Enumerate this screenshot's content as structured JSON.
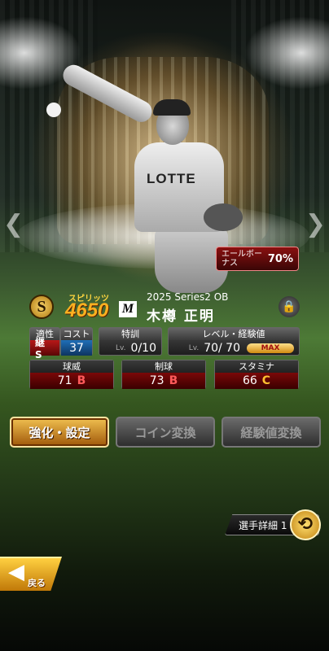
{
  "card": {
    "yell_bonus_label": "エールボーナス",
    "yell_bonus_value": "70%",
    "rank": "S",
    "spirits_label": "スピリッツ",
    "spirits_value": "4650",
    "team_logo": "M",
    "series": "2025 Series2 OB",
    "player_name": "木樽 正明",
    "jersey_text": "LOTTE",
    "icons": {
      "lock": "lock-icon",
      "prev": "chevron-left-icon",
      "next": "chevron-right-icon",
      "swap": "swap-icon",
      "back": "back-arrow-icon"
    }
  },
  "stats": {
    "aptitude": {
      "label": "適性",
      "value": "継 S"
    },
    "cost": {
      "label": "コスト",
      "value": "37"
    },
    "training": {
      "label": "特訓",
      "lv": "Lv.",
      "value": "0/10"
    },
    "level": {
      "label": "レベル・経験値",
      "lv": "Lv.",
      "value": "70/ 70",
      "max": "MAX"
    },
    "power": {
      "label": "球威",
      "value": "71",
      "grade": "B"
    },
    "control": {
      "label": "制球",
      "value": "73",
      "grade": "B"
    },
    "stamina": {
      "label": "スタミナ",
      "value": "66",
      "grade": "C"
    }
  },
  "buttons": {
    "enhance": "強化・設定",
    "coin": "コイン変換",
    "exp": "経験値変換",
    "detail": "選手詳細 1",
    "back": "戻る"
  },
  "colors": {
    "grade_b": "#ff5a5a",
    "grade_c": "#ffc030",
    "accent_gold": "#f0c050"
  }
}
